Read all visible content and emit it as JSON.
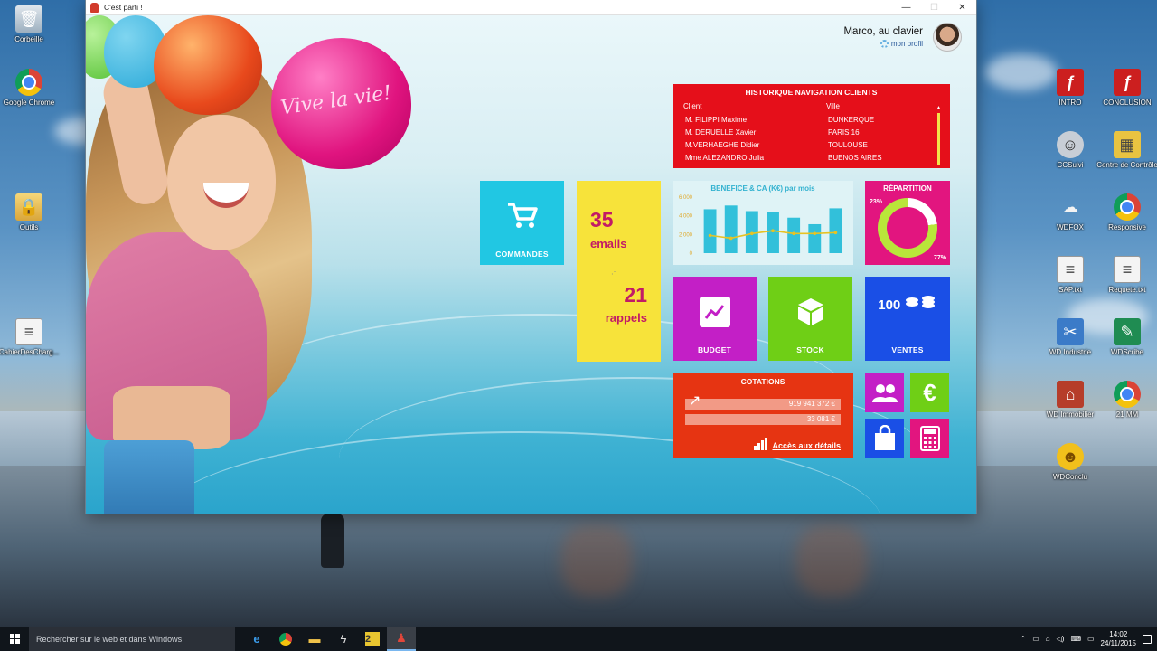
{
  "desktop": {
    "icons_left": [
      {
        "label": "Corbeille",
        "icon": "recycle-bin-icon"
      },
      {
        "label": "Google Chrome",
        "icon": "chrome-icon"
      },
      {
        "label": "Outils",
        "icon": "folder-icon"
      },
      {
        "label": "CahierDesCharg...",
        "icon": "document-icon"
      }
    ],
    "icons_right": [
      {
        "label": "INTRO",
        "icon": "flash-icon"
      },
      {
        "label": "CONCLUSION",
        "icon": "flash-icon"
      },
      {
        "label": "CCSuivi",
        "icon": "ccsuivi-icon"
      },
      {
        "label": "Centre de Contrôle",
        "icon": "control-center-icon"
      },
      {
        "label": "WDFOX",
        "icon": "weather-cloud-icon"
      },
      {
        "label": "Responsive",
        "icon": "chrome-icon"
      },
      {
        "label": "SAP.txt",
        "icon": "document-icon"
      },
      {
        "label": "Requete.txt",
        "icon": "document-icon"
      },
      {
        "label": "WD Industrie",
        "icon": "tools-icon"
      },
      {
        "label": "WDScribe",
        "icon": "pen-icon"
      },
      {
        "label": "WD Immobilier",
        "icon": "house-icon"
      },
      {
        "label": "21 MM",
        "icon": "chrome-icon"
      },
      {
        "label": "WDConclu",
        "icon": "smiley-icon"
      }
    ]
  },
  "window": {
    "title": "C'est parti !",
    "controls": {
      "minimize": "—",
      "maximize": "☐",
      "close": "✕"
    }
  },
  "header": {
    "user_name": "Marco, au clavier",
    "profile_link": "mon profil"
  },
  "hero": {
    "balloon_text": "Vive la vie!"
  },
  "history": {
    "title": "HISTORIQUE NAVIGATION CLIENTS",
    "col_client": "Client",
    "col_city": "Ville",
    "scroll_marker": "▲",
    "rows": [
      {
        "client": "M. FILIPPI Maxime",
        "city": "DUNKERQUE"
      },
      {
        "client": "M. DERUELLE Xavier",
        "city": "PARIS 16"
      },
      {
        "client": "M.VERHAEGHE Didier",
        "city": "TOULOUSE"
      },
      {
        "client": "Mme ALEZANDRO Julia",
        "city": "BUENOS AIRES"
      }
    ]
  },
  "tiles": {
    "commandes": {
      "label": "COMMANDES",
      "icon": "cart-icon"
    },
    "emails_count": "35",
    "emails_label": "emails",
    "rappels_count": "21",
    "rappels_label": "rappels",
    "budget": {
      "label": "BUDGET",
      "icon": "trend-chart-icon"
    },
    "stock": {
      "label": "STOCK",
      "icon": "cube-icon"
    },
    "ventes": {
      "label": "VENTES",
      "icon": "coins-icon",
      "icon_text": "100"
    }
  },
  "repartition": {
    "title": "RÉPARTITION",
    "small_pct": "23%",
    "large_pct": "77%",
    "small_fraction": 0.23,
    "colors": {
      "small": "#ffffff",
      "large": "#b9e63a"
    }
  },
  "chart_data": {
    "type": "bar",
    "title": "BENEFICE & CA (K€) par mois",
    "y_ticks": [
      "6 000",
      "4 000",
      "2 000",
      "0"
    ],
    "ylim": [
      0,
      6000
    ],
    "series": [
      {
        "values": [
          4700,
          5100,
          4500,
          4400,
          3800,
          3100,
          4800
        ]
      },
      {
        "values": [
          1900,
          1600,
          2100,
          2400,
          2100,
          2100,
          2200
        ]
      }
    ],
    "colors": {
      "bars": "#32c0da",
      "line": "#e7c323"
    }
  },
  "cotations": {
    "title": "COTATIONS",
    "value1": "919 941 372 €",
    "value2": "33 081 €",
    "link": "Accès aux détails"
  },
  "mini_tiles": [
    {
      "name": "users",
      "icon": "users-icon"
    },
    {
      "name": "euro",
      "icon": "euro-icon",
      "glyph": "€"
    },
    {
      "name": "shopping",
      "icon": "shopping-bag-icon"
    },
    {
      "name": "calculator",
      "icon": "calculator-icon"
    }
  ],
  "taskbar": {
    "search_placeholder": "Rechercher sur le web et dans Windows",
    "time": "14:02",
    "date": "24/11/2015"
  }
}
